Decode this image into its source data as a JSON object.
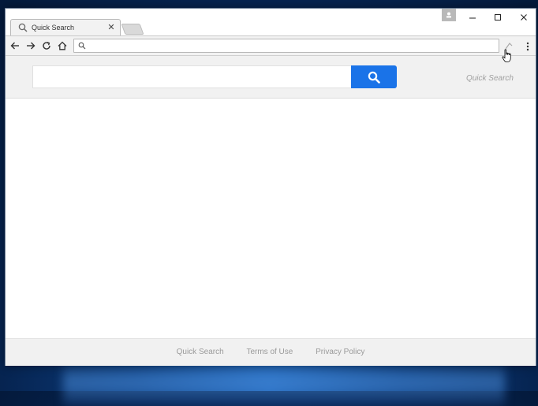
{
  "browser": {
    "tab": {
      "title": "Quick Search",
      "close_glyph": "✕",
      "icon": "search-icon"
    },
    "window_controls": {
      "minimize": "–",
      "maximize": "☐",
      "close": "✕"
    },
    "omnibox": {
      "value": "",
      "placeholder": ""
    },
    "toolbar": {
      "menu_glyph": "⋮"
    }
  },
  "page": {
    "search": {
      "value": "",
      "placeholder": "",
      "button_icon": "search-icon"
    },
    "brand": "Quick Search",
    "footer": {
      "links": [
        "Quick Search",
        "Terms of Use",
        "Privacy Policy"
      ]
    }
  },
  "colors": {
    "search_button": "#1a73e8",
    "desktop": "#0c3b7a"
  }
}
